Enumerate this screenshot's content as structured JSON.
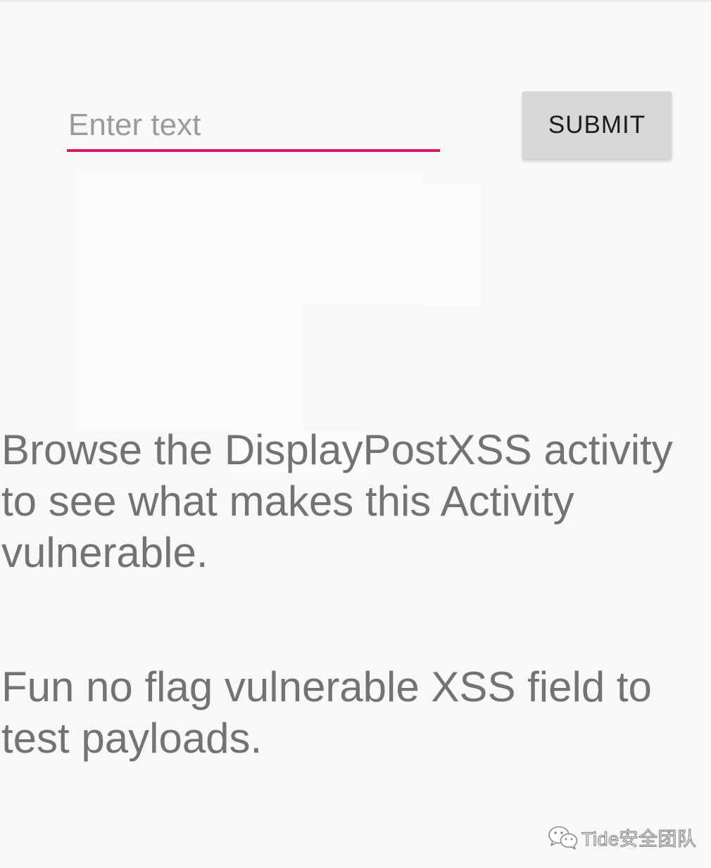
{
  "form": {
    "input": {
      "value": "",
      "placeholder": "Enter text"
    },
    "submit_label": "SUBMIT"
  },
  "content": {
    "paragraph_1": "Browse the DisplayPostXSS activity to see what makes this Activity vulnerable.",
    "paragraph_2": "Fun no flag vulnerable XSS field to test payloads."
  },
  "watermark": {
    "icon": "wechat-icon",
    "text": "Tide安全团队"
  },
  "colors": {
    "accent": "#d81b60",
    "background": "#f7f8f8",
    "button_bg": "#d6d7d7",
    "body_text": "#737373"
  }
}
